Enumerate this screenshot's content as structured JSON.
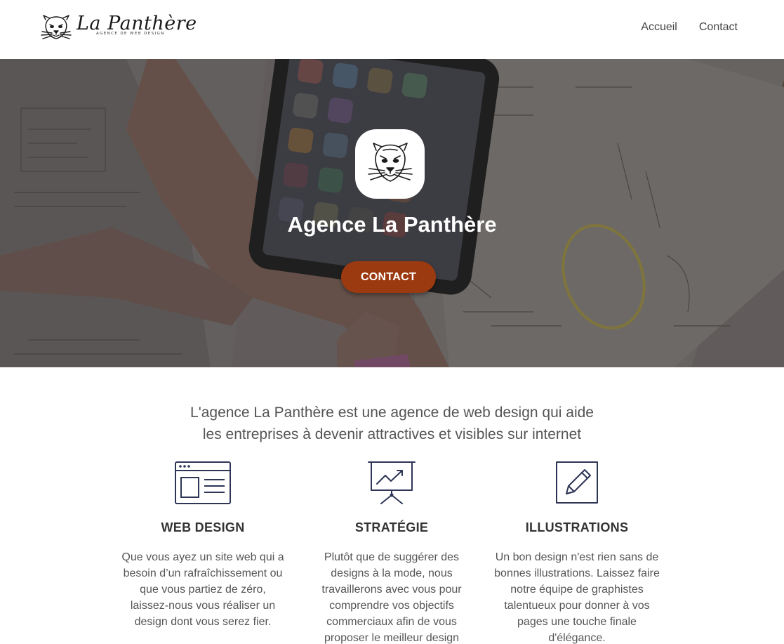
{
  "brand": {
    "name": "La Panthère",
    "tagline": "AGENCE DE WEB DESIGN"
  },
  "nav": {
    "items": [
      {
        "label": "Accueil"
      },
      {
        "label": "Contact"
      }
    ]
  },
  "hero": {
    "title": "Agence La Panthère",
    "button_label": "CONTACT",
    "button_color": "#9b3a10"
  },
  "intro": {
    "line1": "L'agence La Panthère est une agence de web design qui aide",
    "line2": "les entreprises à devenir attractives et visibles sur internet"
  },
  "features": [
    {
      "icon": "browser-window-icon",
      "title": "WEB DESIGN",
      "lines": [
        "Que vous ayez un site web qui a",
        "besoin d’un rafraîchissement ou",
        "que vous partiez de zéro,",
        "laissez-nous vous réaliser un",
        "design dont vous serez fier."
      ]
    },
    {
      "icon": "presentation-chart-icon",
      "title": "STRATÉGIE",
      "lines": [
        "Plutôt que de suggérer des",
        "designs à la mode, nous",
        "travaillerons avec vous pour",
        "comprendre vos objectifs",
        "commerciaux afin de vous",
        "proposer le meilleur design"
      ]
    },
    {
      "icon": "pencil-edit-icon",
      "title": "ILLUSTRATIONS",
      "lines": [
        "Un bon design n'est rien sans de",
        "bonnes illustrations. Laissez faire",
        "notre équipe de graphistes",
        "talentueux pour donner à vos",
        "pages une touche finale",
        "d'élégance."
      ]
    }
  ]
}
